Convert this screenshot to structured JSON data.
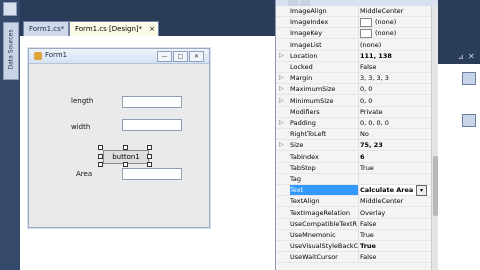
{
  "left_sidebar": {
    "data_sources_label": "Data Sources"
  },
  "doc_tabs": [
    {
      "label": "Form1.cs*"
    },
    {
      "label": "Form1.cs [Design]*",
      "close": "×"
    }
  ],
  "form": {
    "title": "Form1",
    "window_buttons": {
      "minimize": "—",
      "maximize": "□",
      "close": "✕"
    },
    "labels": {
      "length": "length",
      "width": "width",
      "area": "Area"
    },
    "button1": "button1"
  },
  "properties": [
    {
      "name": "ImageAlign",
      "value": "MiddleCenter"
    },
    {
      "name": "ImageIndex",
      "value": "(none)",
      "swatch": true
    },
    {
      "name": "ImageKey",
      "value": "(none)",
      "swatch": true
    },
    {
      "name": "ImageList",
      "value": "(none)"
    },
    {
      "name": "Location",
      "value": "111, 138",
      "expander": "▷",
      "bold": true
    },
    {
      "name": "Locked",
      "value": "False"
    },
    {
      "name": "Margin",
      "value": "3, 3, 3, 3",
      "expander": "▷"
    },
    {
      "name": "MaximumSize",
      "value": "0, 0",
      "expander": "▷"
    },
    {
      "name": "MinimumSize",
      "value": "0, 0",
      "expander": "▷"
    },
    {
      "name": "Modifiers",
      "value": "Private"
    },
    {
      "name": "Padding",
      "value": "0, 0, 0, 0",
      "expander": "▷"
    },
    {
      "name": "RightToLeft",
      "value": "No"
    },
    {
      "name": "Size",
      "value": "75, 23",
      "expander": "▷",
      "bold": true
    },
    {
      "name": "TabIndex",
      "value": "6",
      "bold": true
    },
    {
      "name": "TabStop",
      "value": "True"
    },
    {
      "name": "Tag",
      "value": ""
    },
    {
      "name": "Text",
      "value": "Calculate Area",
      "bold": true,
      "selected": true
    },
    {
      "name": "TextAlign",
      "value": "MiddleCenter"
    },
    {
      "name": "TextImageRelation",
      "value": "Overlay"
    },
    {
      "name": "UseCompatibleTextR",
      "value": "False"
    },
    {
      "name": "UseMnemonic",
      "value": "True"
    },
    {
      "name": "UseVisualStyleBackC",
      "value": "True",
      "bold": true
    },
    {
      "name": "UseWaitCursor",
      "value": "False"
    }
  ],
  "right_panel": {
    "pin": "⊿",
    "close": "✕"
  }
}
